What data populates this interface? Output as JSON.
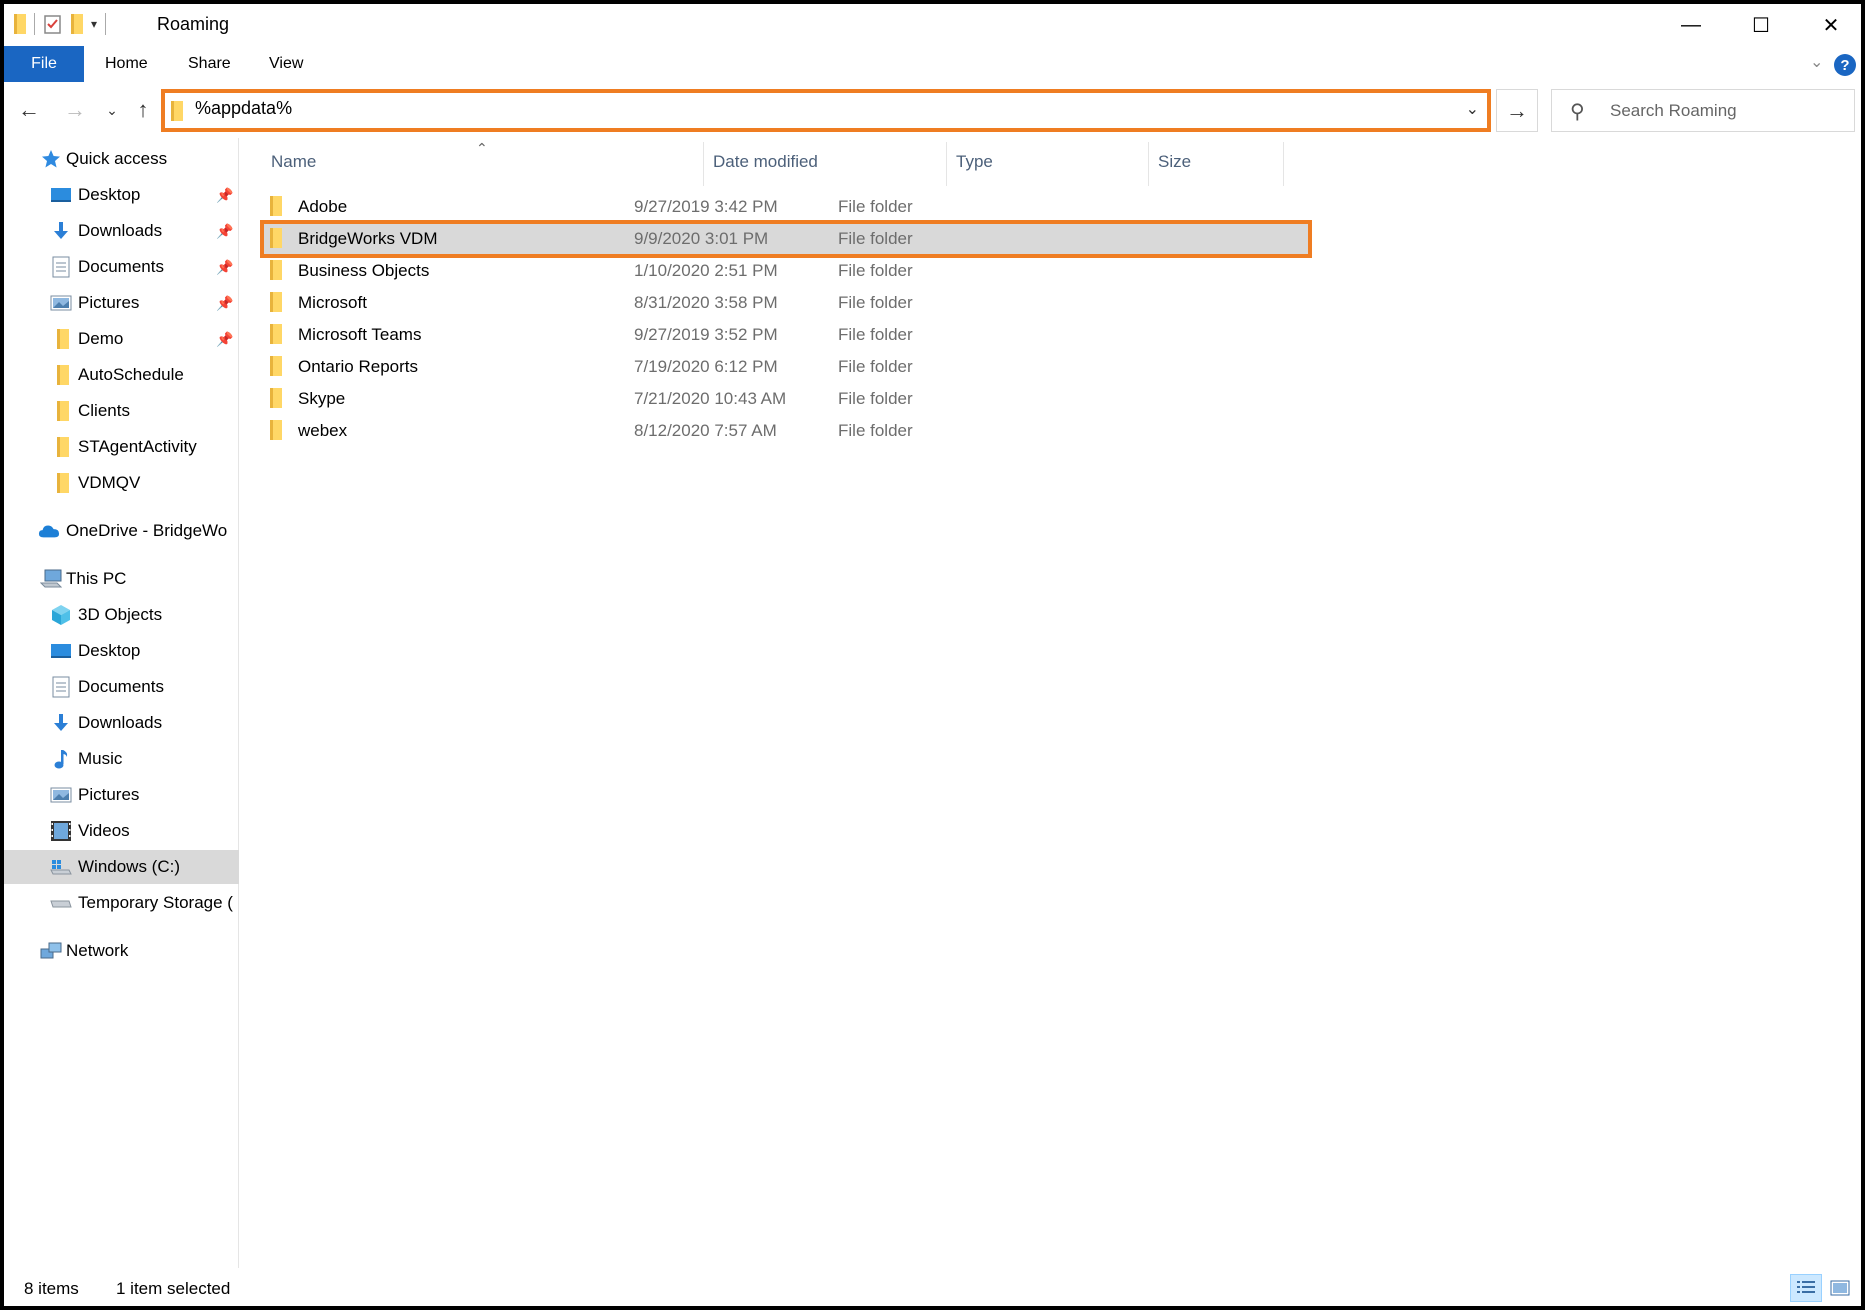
{
  "window": {
    "title": "Roaming",
    "controls": {
      "minimize": "—",
      "maximize": "☐",
      "close": "✕"
    }
  },
  "ribbon": {
    "file_tab": "File",
    "tabs": [
      "Home",
      "Share",
      "View"
    ],
    "help": "?"
  },
  "address": {
    "value": "%appdata%",
    "search_placeholder": "Search Roaming"
  },
  "nav_pane": {
    "quick_access": {
      "label": "Quick access",
      "items": [
        {
          "label": "Desktop",
          "icon": "desktop-icon",
          "pinned": true
        },
        {
          "label": "Downloads",
          "icon": "downloads-icon",
          "pinned": true
        },
        {
          "label": "Documents",
          "icon": "documents-icon",
          "pinned": true
        },
        {
          "label": "Pictures",
          "icon": "pictures-icon",
          "pinned": true
        },
        {
          "label": "Demo",
          "icon": "folder-icon",
          "pinned": true
        },
        {
          "label": "AutoSchedule",
          "icon": "folder-icon",
          "pinned": false
        },
        {
          "label": "Clients",
          "icon": "folder-icon",
          "pinned": false
        },
        {
          "label": "STAgentActivity",
          "icon": "folder-icon",
          "pinned": false
        },
        {
          "label": "VDMQV",
          "icon": "folder-icon",
          "pinned": false
        }
      ]
    },
    "onedrive": {
      "label": "OneDrive - BridgeWo"
    },
    "this_pc": {
      "label": "This PC",
      "items": [
        {
          "label": "3D Objects",
          "icon": "3d-objects-icon"
        },
        {
          "label": "Desktop",
          "icon": "desktop-icon"
        },
        {
          "label": "Documents",
          "icon": "documents-icon"
        },
        {
          "label": "Downloads",
          "icon": "downloads-icon"
        },
        {
          "label": "Music",
          "icon": "music-icon"
        },
        {
          "label": "Pictures",
          "icon": "pictures-icon"
        },
        {
          "label": "Videos",
          "icon": "videos-icon"
        },
        {
          "label": "Windows (C:)",
          "icon": "drive-icon",
          "selected": true
        },
        {
          "label": "Temporary Storage (",
          "icon": "drive-icon"
        }
      ]
    },
    "network": {
      "label": "Network"
    }
  },
  "file_list": {
    "columns": [
      "Name",
      "Date modified",
      "Type",
      "Size"
    ],
    "rows": [
      {
        "name": "Adobe",
        "date": "9/27/2019 3:42 PM",
        "type": "File folder"
      },
      {
        "name": "BridgeWorks VDM",
        "date": "9/9/2020 3:01 PM",
        "type": "File folder",
        "selected": true
      },
      {
        "name": "Business Objects",
        "date": "1/10/2020 2:51 PM",
        "type": "File folder"
      },
      {
        "name": "Microsoft",
        "date": "8/31/2020 3:58 PM",
        "type": "File folder"
      },
      {
        "name": "Microsoft Teams",
        "date": "9/27/2019 3:52 PM",
        "type": "File folder"
      },
      {
        "name": "Ontario Reports",
        "date": "7/19/2020 6:12 PM",
        "type": "File folder"
      },
      {
        "name": "Skype",
        "date": "7/21/2020 10:43 AM",
        "type": "File folder"
      },
      {
        "name": "webex",
        "date": "8/12/2020 7:57 AM",
        "type": "File folder"
      }
    ]
  },
  "status": {
    "item_count": "8 items",
    "selection": "1 item selected"
  },
  "colors": {
    "accent_blue": "#1a66c2",
    "highlight_orange": "#ef7d22",
    "selection_gray": "#d9d9d9"
  }
}
